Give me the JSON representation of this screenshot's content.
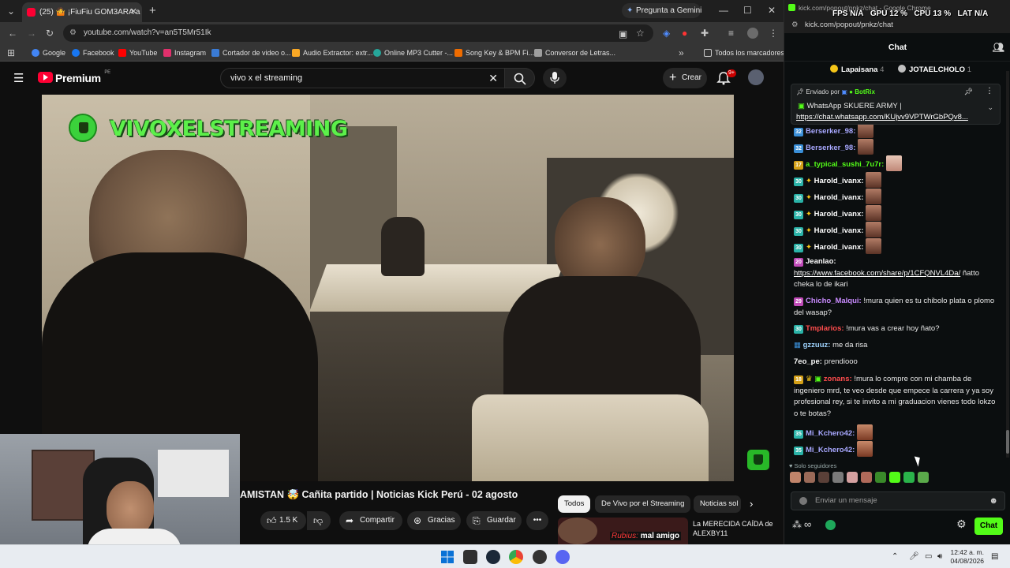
{
  "browser": {
    "tab_title": "(25) 🤷 ¡FiuFiu GOM3ARA a Sid",
    "gemini_label": "Pregunta a Gemini",
    "url": "youtube.com/watch?v=an5T5Mr51Ik",
    "bookmarks": [
      {
        "label": "Google",
        "color": "#4285f4"
      },
      {
        "label": "Facebook",
        "color": "#1877f2"
      },
      {
        "label": "YouTube",
        "color": "#ff0000"
      },
      {
        "label": "Instagram",
        "color": "#e1306c"
      },
      {
        "label": "Cortador de video o...",
        "color": "#3a7bd5"
      },
      {
        "label": "Audio Extractor: extr...",
        "color": "#f9a825"
      },
      {
        "label": "Online MP3 Cutter -...",
        "color": "#26a69a"
      },
      {
        "label": "Song Key & BPM Fi...",
        "color": "#ef6c00"
      },
      {
        "label": "Conversor de Letras...",
        "color": "#9e9e9e"
      }
    ],
    "all_bookmarks": "Todos los marcadores"
  },
  "youtube": {
    "logo_text": "Premium",
    "logo_region": "PE",
    "search_value": "vivo x el streaming",
    "create_label": "Crear",
    "notif_count": "9+",
    "watermark": "VIVOXELSTREAMING",
    "video_title": "AMISTAN 🤯 Cañita partido | Noticias Kick Perú - 02 agosto",
    "like_count": "1.5 K",
    "share_label": "Compartir",
    "thanks_label": "Gracias",
    "save_label": "Guardar",
    "chips": [
      "Todos",
      "De Vivo por el Streaming",
      "Noticias sol"
    ],
    "rec_overlay_name": "Rubius:",
    "rec_overlay_text": "mal amigo",
    "rec_title": "La MERECIDA CAÍDA de ALEXBY11"
  },
  "chat_window": {
    "title": "kick.com/popout/pnkz/chat - Google Chrome",
    "url": "kick.com/popout/pnkz/chat",
    "perf": {
      "fps_label": "FPS",
      "fps": "N/A",
      "gpu_label": "GPU",
      "gpu": "12 %",
      "cpu_label": "CPU",
      "cpu": "13 %",
      "lat_label": "LAT",
      "lat": "N/A"
    },
    "header": "Chat",
    "gifters": [
      {
        "name": "Lapaisana",
        "count": "4",
        "color": "#f5c518"
      },
      {
        "name": "JOTAELCHOLO",
        "count": "1",
        "color": "#c0c0c0"
      }
    ],
    "pinned": {
      "sent_by": "Enviado por",
      "sender": "BotRix",
      "text": "WhatsApp SKUERE ARMY |",
      "link": "https://chat.whatsapp.com/KUjvv9VPTWrGbPQv8..."
    },
    "messages": [
      {
        "level": "32",
        "user": "Berserker_98:",
        "color": "#a8a8ff",
        "text": "",
        "emote": true
      },
      {
        "level": "32",
        "user": "Berserker_98:",
        "color": "#a8a8ff",
        "text": "",
        "emote": true
      },
      {
        "level": "17",
        "user": "a_typical_sushi_7u7r:",
        "color": "#53fc18",
        "text": "",
        "emote": true
      },
      {
        "level": "30",
        "user": "Harold_ivanx:",
        "color": "#ffffff",
        "text": "",
        "emote": true
      },
      {
        "level": "30",
        "user": "Harold_ivanx:",
        "color": "#ffffff",
        "text": "",
        "emote": true
      },
      {
        "level": "30",
        "user": "Harold_ivanx:",
        "color": "#ffffff",
        "text": "",
        "emote": true
      },
      {
        "level": "30",
        "user": "Harold_ivanx:",
        "color": "#ffffff",
        "text": "",
        "emote": true
      },
      {
        "level": "30",
        "user": "Harold_ivanx:",
        "color": "#ffffff",
        "text": "",
        "emote": true
      },
      {
        "level": "20",
        "user": "Jeanlao:",
        "color": "#ffffff",
        "link": "https://www.facebook.com/share/p/1CFQNVL4Da/",
        "text": " ñatto cheka lo de ikari"
      },
      {
        "level": "29",
        "user": "Chicho_Malqui:",
        "color": "#c98bff",
        "text": " !mura quien es tu chibolo plata o plomo del wasap?"
      },
      {
        "level": "30",
        "user": "Tmplarios:",
        "color": "#ff4d4d",
        "text": " !mura vas a crear hoy ñato?"
      },
      {
        "level": "",
        "user": "gzzuuz:",
        "color": "#9fd4ff",
        "text": " me da risa"
      },
      {
        "level": "",
        "user": "7eo_pe:",
        "color": "#ffffff",
        "text": " prendiooo"
      },
      {
        "level": "18",
        "user": "zonans:",
        "color": "#ff4d4d",
        "text": " !mura lo compre con mi chamba de ingeniero mrd, te veo desde que empece la carrera y ya soy profesional rey, si te invito a mi graduacion vienes todo lokzo o te botas?"
      },
      {
        "level": "35",
        "user": "Mi_Kchero42:",
        "color": "#a8a8ff",
        "text": "",
        "emote": true
      },
      {
        "level": "35",
        "user": "Mi_Kchero42:",
        "color": "#a8a8ff",
        "text": "",
        "emote": true
      }
    ],
    "followers_only": "Solo seguidores",
    "input_placeholder": "Enviar un mensaje",
    "chat_button": "Chat"
  },
  "taskbar": {
    "time": "12:42 a. m.",
    "date": "04/08/2026"
  }
}
